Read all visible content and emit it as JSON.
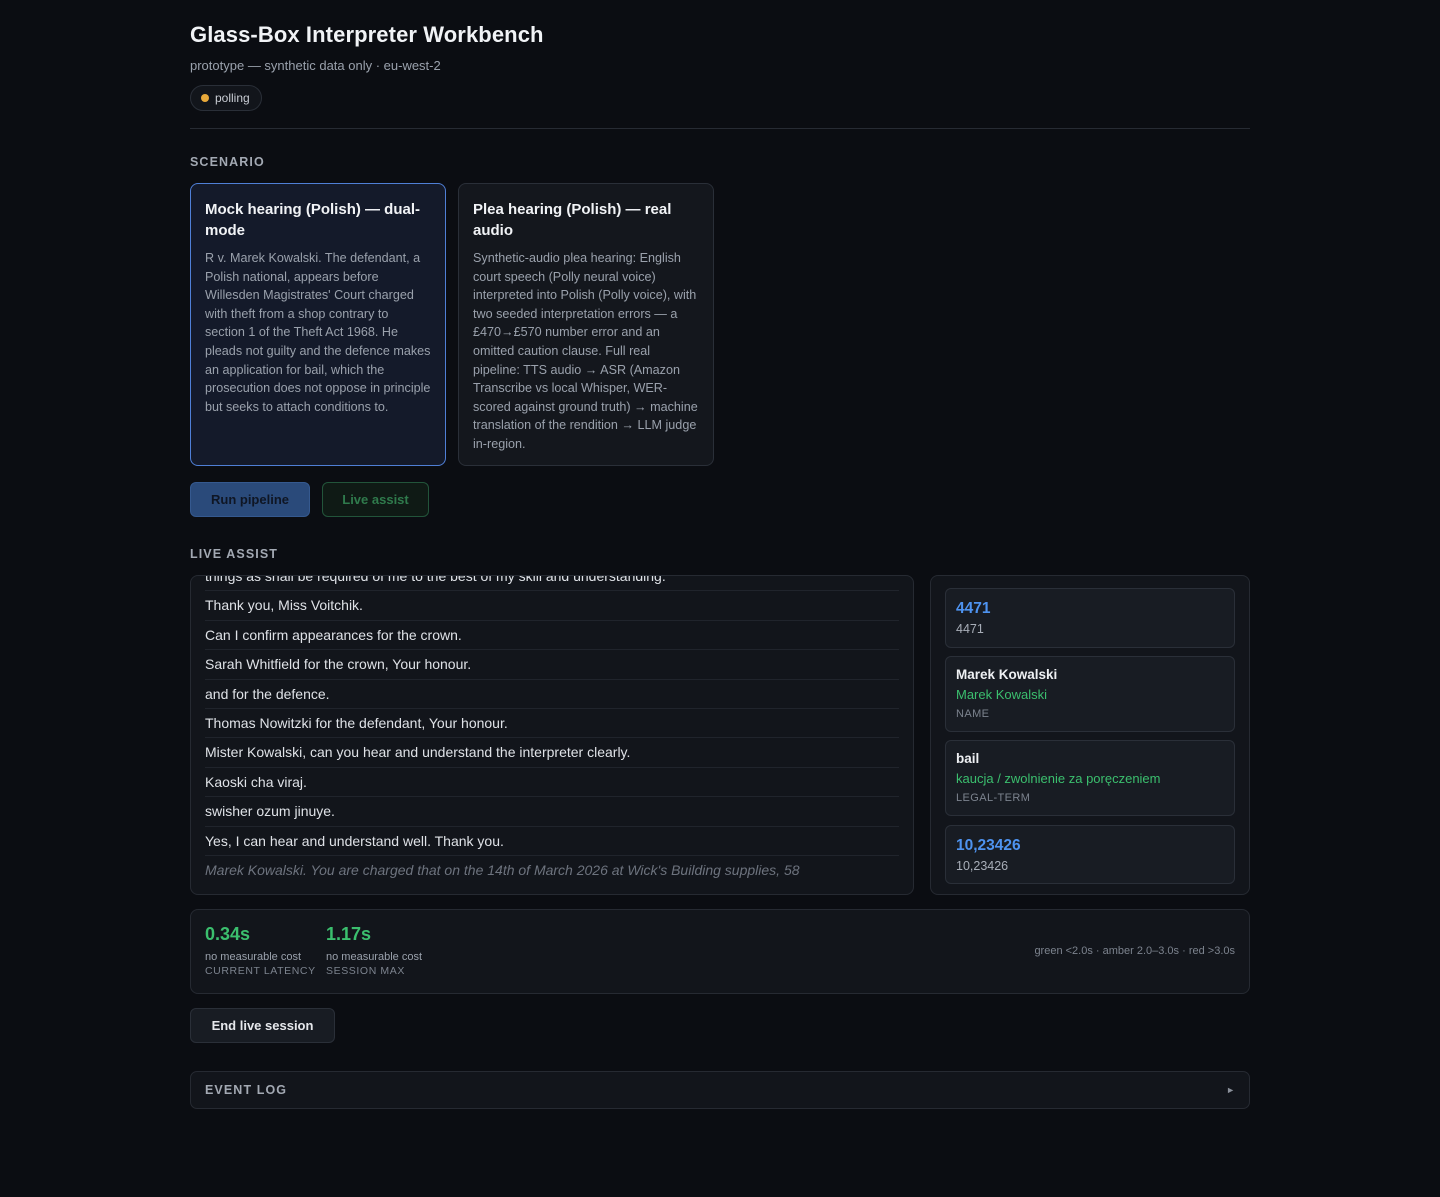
{
  "header": {
    "title": "Glass-Box Interpreter Workbench",
    "subtitle": "prototype — synthetic data only · eu-west-2",
    "status_badge": "polling"
  },
  "scenario": {
    "section_label": "SCENARIO",
    "cards": [
      {
        "title": "Mock hearing (Polish) — dual-mode",
        "description": "R v. Marek Kowalski. The defendant, a Polish national, appears before Willesden Magistrates' Court charged with theft from a shop contrary to section 1 of the Theft Act 1968. He pleads not guilty and the defence makes an application for bail, which the prosecution does not oppose in principle but seeks to attach conditions to.",
        "selected": true
      },
      {
        "title": "Plea hearing (Polish) — real audio",
        "description": "Synthetic-audio plea hearing: English court speech (Polly neural voice) interpreted into Polish (Polly voice), with two seeded interpretation errors — a £470→£570 number error and an omitted caution clause. Full real pipeline: TTS audio → ASR (Amazon Transcribe vs local Whisper, WER-scored against ground truth) → machine translation of the rendition → LLM judge in-region.",
        "selected": false
      }
    ],
    "run_button": "Run pipeline",
    "live_button": "Live assist"
  },
  "live_assist": {
    "section_label": "LIVE ASSIST",
    "transcript": [
      "things as shall be required of me to the best of my skill and understanding.",
      "Thank you, Miss Voitchik.",
      "Can I confirm appearances for the crown.",
      "Sarah Whitfield for the crown, Your honour.",
      "and for the defence.",
      "Thomas Nowitzki for the defendant, Your honour.",
      "Mister Kowalski, can you hear and understand the interpreter clearly.",
      "Kaoski cha viraj.",
      "swisher ozum jinuye.",
      "Yes, I can hear and understand well. Thank you."
    ],
    "partial": "Marek Kowalski. You are charged that on the 14th of March 2026 at Wick's Building supplies, 58",
    "glossary": [
      {
        "kind": "number",
        "value": "4471",
        "detail": "4471"
      },
      {
        "kind": "term",
        "term": "Marek Kowalski",
        "translation": "Marek Kowalski",
        "category": "NAME"
      },
      {
        "kind": "term",
        "term": "bail",
        "translation": "kaucja / zwolnienie za poręczeniem",
        "category": "LEGAL-TERM"
      },
      {
        "kind": "number",
        "value": "10,23426",
        "detail": "10,23426"
      }
    ]
  },
  "latency": {
    "current": {
      "value": "0.34s",
      "cost": "no measurable cost",
      "label": "CURRENT LATENCY"
    },
    "session_max": {
      "value": "1.17s",
      "cost": "no measurable cost",
      "label": "SESSION MAX"
    },
    "legend": "green <2.0s · amber 2.0–3.0s · red >3.0s",
    "colors": {
      "green": "#3bbf6e",
      "amber": "#e8a93a"
    }
  },
  "end_button": "End live session",
  "event_log": {
    "label": "EVENT LOG",
    "icon": "chevron-right-icon"
  }
}
